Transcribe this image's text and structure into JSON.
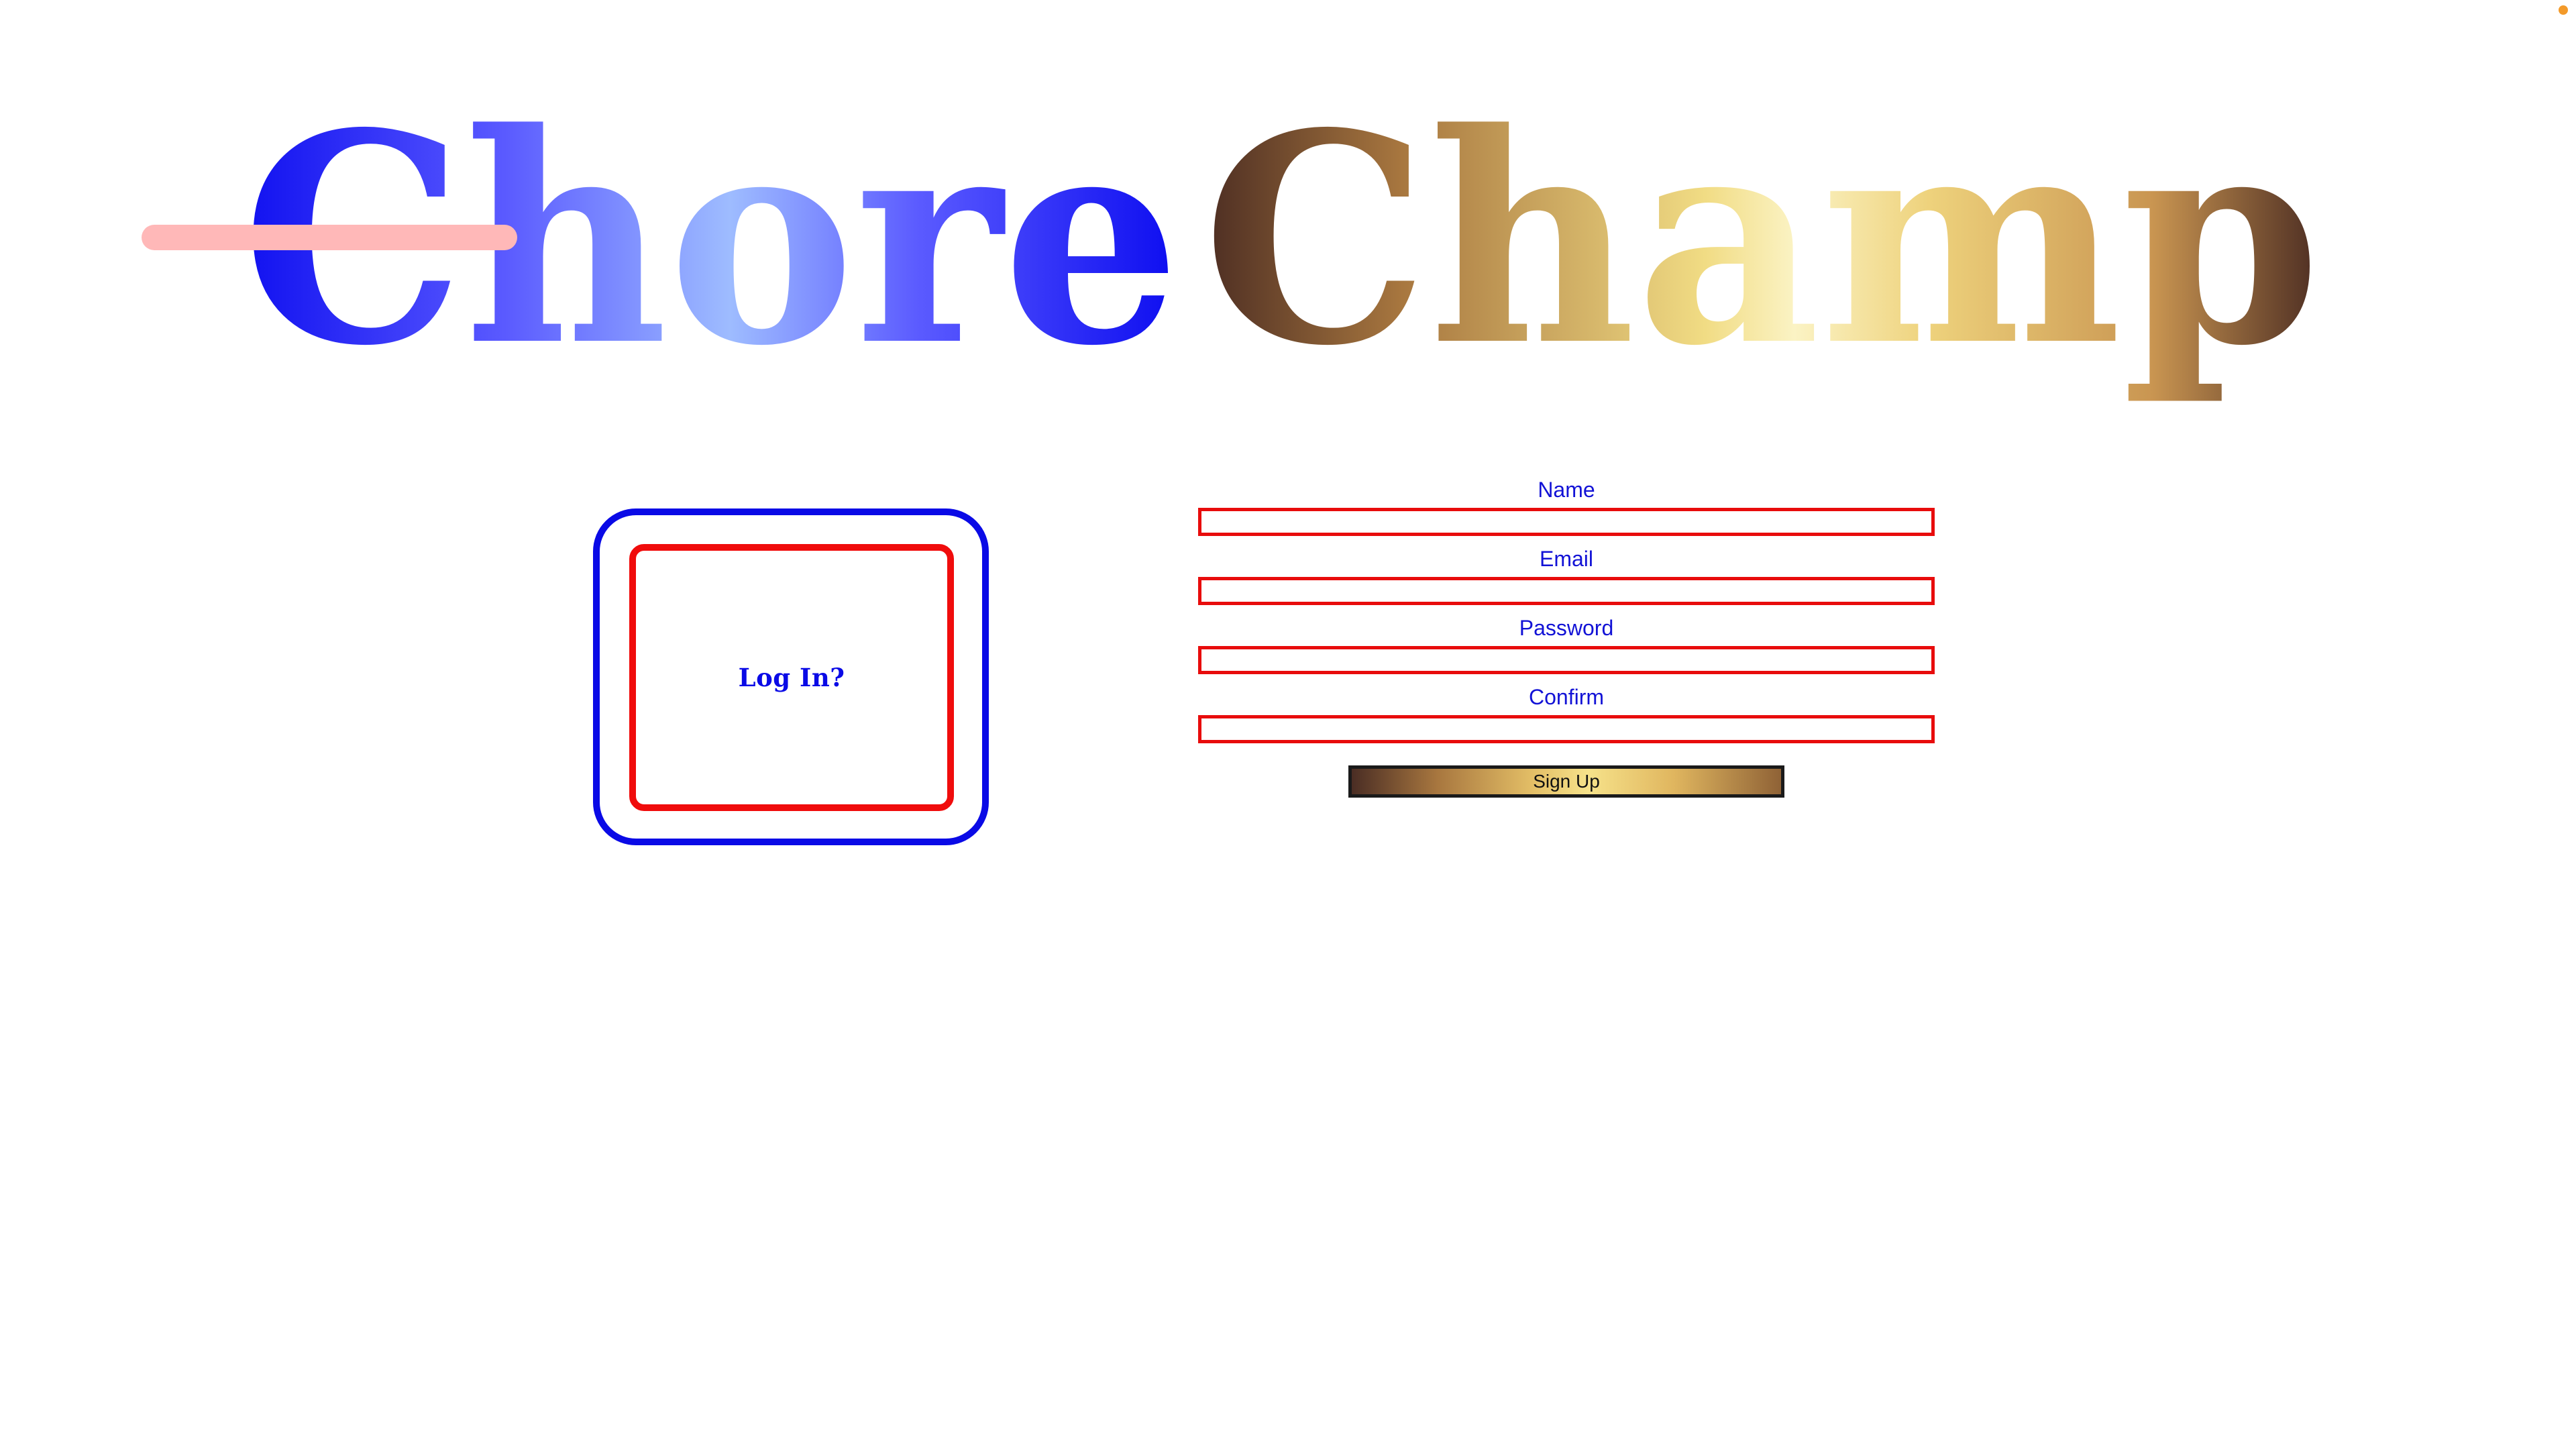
{
  "logo": {
    "part1": "Chore",
    "part2": "Champ"
  },
  "login": {
    "label": "Log In?"
  },
  "form": {
    "fields": [
      {
        "label": "Name",
        "value": ""
      },
      {
        "label": "Email",
        "value": ""
      },
      {
        "label": "Password",
        "value": ""
      },
      {
        "label": "Confirm",
        "value": ""
      }
    ],
    "signup_label": "Sign Up"
  },
  "colors": {
    "blue": "#0a0ae6",
    "red": "#f00c0c",
    "gold": "#e3be66",
    "brown": "#4a2d24",
    "strike": "#ffb8b8"
  }
}
